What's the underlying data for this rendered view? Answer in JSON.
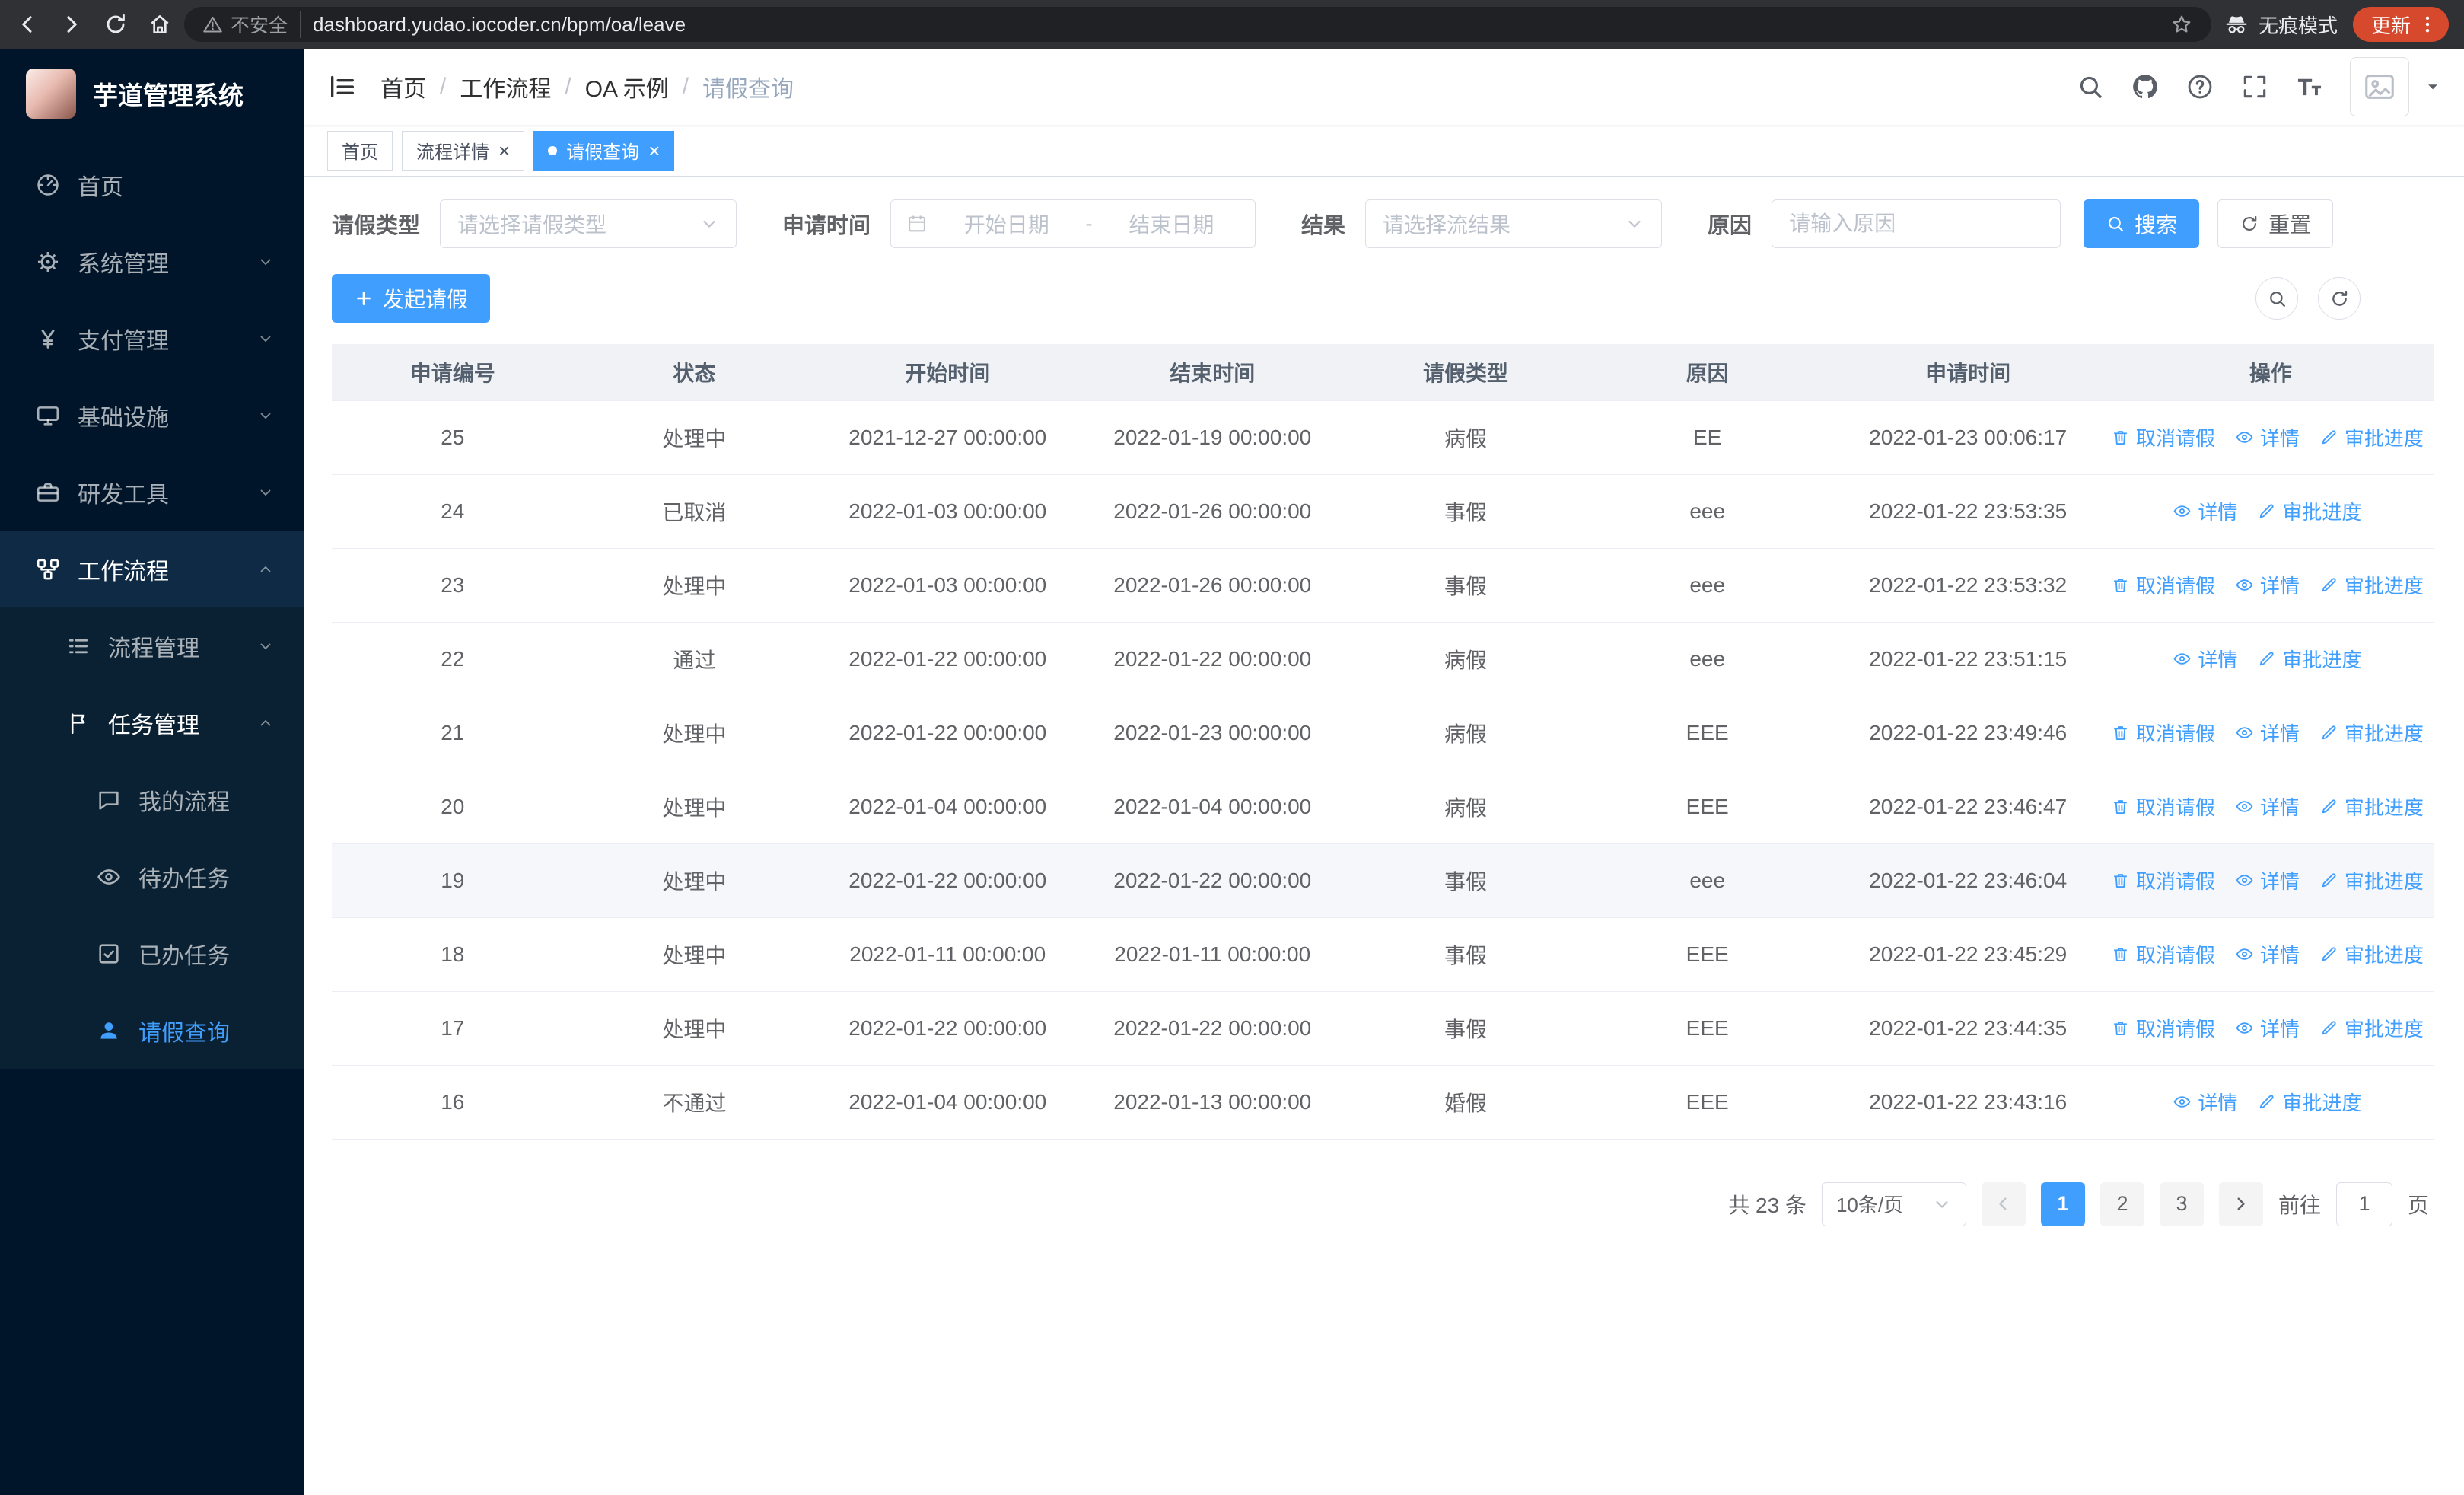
{
  "browser": {
    "security_label": "不安全",
    "url": "dashboard.yudao.iocoder.cn/bpm/oa/leave",
    "incognito_label": "无痕模式",
    "update_label": "更新"
  },
  "sidebar": {
    "logo_title": "芋道管理系统",
    "items": [
      {
        "key": "home",
        "label": "首页",
        "icon": "dashboard-icon",
        "level": 1
      },
      {
        "key": "system",
        "label": "系统管理",
        "icon": "gear-icon",
        "level": 1,
        "expand": "down"
      },
      {
        "key": "payment",
        "label": "支付管理",
        "icon": "yen-icon",
        "level": 1,
        "expand": "down"
      },
      {
        "key": "infrastructure",
        "label": "基础设施",
        "icon": "monitor-icon",
        "level": 1,
        "expand": "down"
      },
      {
        "key": "devtools",
        "label": "研发工具",
        "icon": "tools-icon",
        "level": 1,
        "expand": "down"
      },
      {
        "key": "workflow",
        "label": "工作流程",
        "icon": "workflow-icon",
        "level": 1,
        "expand": "up",
        "open": true,
        "hl": true
      },
      {
        "key": "process-mgmt",
        "label": "流程管理",
        "icon": "process-icon",
        "level": 2,
        "expand": "down",
        "shaded": true
      },
      {
        "key": "task-mgmt",
        "label": "任务管理",
        "icon": "task-icon",
        "level": 2,
        "expand": "up",
        "open": true,
        "shaded": true
      },
      {
        "key": "my-process",
        "label": "我的流程",
        "icon": "chat-icon",
        "level": 3,
        "shaded": true
      },
      {
        "key": "todo-tasks",
        "label": "待办任务",
        "icon": "eye-icon",
        "level": 3,
        "shaded": true
      },
      {
        "key": "done-tasks",
        "label": "已办任务",
        "icon": "check-square-icon",
        "level": 3,
        "shaded": true
      },
      {
        "key": "leave-query",
        "label": "请假查询",
        "icon": "user-icon",
        "level": 3,
        "active": true,
        "shaded": true
      }
    ]
  },
  "header": {
    "breadcrumb": [
      "首页",
      "工作流程",
      "OA 示例",
      "请假查询"
    ]
  },
  "tabs": [
    {
      "key": "home",
      "label": "首页",
      "active": false,
      "closable": false
    },
    {
      "key": "process-detail",
      "label": "流程详情",
      "active": false,
      "closable": true
    },
    {
      "key": "leave-query",
      "label": "请假查询",
      "active": true,
      "closable": true
    }
  ],
  "filters": {
    "leave_type_label": "请假类型",
    "leave_type_placeholder": "请选择请假类型",
    "apply_time_label": "申请时间",
    "start_date_placeholder": "开始日期",
    "date_separator": "-",
    "end_date_placeholder": "结束日期",
    "result_label": "结果",
    "result_placeholder": "请选择流结果",
    "reason_label": "原因",
    "reason_placeholder": "请输入原因",
    "search_label": "搜索",
    "reset_label": "重置"
  },
  "toolbar": {
    "create_label": "发起请假"
  },
  "table": {
    "columns": [
      "申请编号",
      "状态",
      "开始时间",
      "结束时间",
      "请假类型",
      "原因",
      "申请时间",
      "操作"
    ],
    "column_keys": [
      "id",
      "status",
      "start",
      "end",
      "type",
      "reason",
      "apply_time"
    ],
    "action_labels": {
      "cancel": "取消请假",
      "detail": "详情",
      "progress": "审批进度"
    },
    "rows": [
      {
        "id": "25",
        "status": "处理中",
        "start": "2021-12-27 00:00:00",
        "end": "2022-01-19 00:00:00",
        "type": "病假",
        "reason": "EE",
        "apply_time": "2022-01-23 00:06:17",
        "actions": [
          "cancel",
          "detail",
          "progress"
        ]
      },
      {
        "id": "24",
        "status": "已取消",
        "start": "2022-01-03 00:00:00",
        "end": "2022-01-26 00:00:00",
        "type": "事假",
        "reason": "eee",
        "apply_time": "2022-01-22 23:53:35",
        "actions": [
          "detail",
          "progress"
        ]
      },
      {
        "id": "23",
        "status": "处理中",
        "start": "2022-01-03 00:00:00",
        "end": "2022-01-26 00:00:00",
        "type": "事假",
        "reason": "eee",
        "apply_time": "2022-01-22 23:53:32",
        "actions": [
          "cancel",
          "detail",
          "progress"
        ]
      },
      {
        "id": "22",
        "status": "通过",
        "start": "2022-01-22 00:00:00",
        "end": "2022-01-22 00:00:00",
        "type": "病假",
        "reason": "eee",
        "apply_time": "2022-01-22 23:51:15",
        "actions": [
          "detail",
          "progress"
        ]
      },
      {
        "id": "21",
        "status": "处理中",
        "start": "2022-01-22 00:00:00",
        "end": "2022-01-23 00:00:00",
        "type": "病假",
        "reason": "EEE",
        "apply_time": "2022-01-22 23:49:46",
        "actions": [
          "cancel",
          "detail",
          "progress"
        ]
      },
      {
        "id": "20",
        "status": "处理中",
        "start": "2022-01-04 00:00:00",
        "end": "2022-01-04 00:00:00",
        "type": "病假",
        "reason": "EEE",
        "apply_time": "2022-01-22 23:46:47",
        "actions": [
          "cancel",
          "detail",
          "progress"
        ]
      },
      {
        "id": "19",
        "status": "处理中",
        "start": "2022-01-22 00:00:00",
        "end": "2022-01-22 00:00:00",
        "type": "事假",
        "reason": "eee",
        "apply_time": "2022-01-22 23:46:04",
        "actions": [
          "cancel",
          "detail",
          "progress"
        ],
        "hover": true
      },
      {
        "id": "18",
        "status": "处理中",
        "start": "2022-01-11 00:00:00",
        "end": "2022-01-11 00:00:00",
        "type": "事假",
        "reason": "EEE",
        "apply_time": "2022-01-22 23:45:29",
        "actions": [
          "cancel",
          "detail",
          "progress"
        ]
      },
      {
        "id": "17",
        "status": "处理中",
        "start": "2022-01-22 00:00:00",
        "end": "2022-01-22 00:00:00",
        "type": "事假",
        "reason": "EEE",
        "apply_time": "2022-01-22 23:44:35",
        "actions": [
          "cancel",
          "detail",
          "progress"
        ]
      },
      {
        "id": "16",
        "status": "不通过",
        "start": "2022-01-04 00:00:00",
        "end": "2022-01-13 00:00:00",
        "type": "婚假",
        "reason": "EEE",
        "apply_time": "2022-01-22 23:43:16",
        "actions": [
          "detail",
          "progress"
        ]
      }
    ]
  },
  "pagination": {
    "total_label": "共 23 条",
    "page_size": "10条/页",
    "pages": [
      "1",
      "2",
      "3"
    ],
    "active_page": "1",
    "goto_label": "前往",
    "goto_value": "1",
    "page_unit": "页"
  },
  "colors": {
    "accent": "#409eff",
    "sidebar_bg": "#001529",
    "update_button_bg": "#d6492c"
  }
}
